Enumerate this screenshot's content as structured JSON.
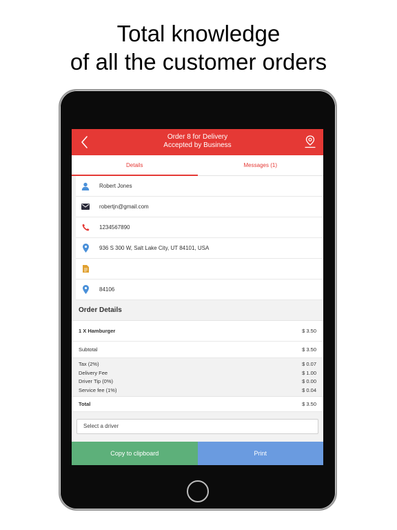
{
  "headline": {
    "line1": "Total knowledge",
    "line2": "of all the customer orders"
  },
  "navbar": {
    "title_line1": "Order 8 for Delivery",
    "title_line2": "Accepted by Business",
    "back_icon": "chevron-left-icon",
    "map_icon": "map-pin-icon"
  },
  "tabs": [
    {
      "label": "Details",
      "active": true
    },
    {
      "label": "Messages (1)",
      "active": false
    }
  ],
  "customer": {
    "name": "Robert Jones",
    "email": "robertjn@gmail.com",
    "phone": "1234567890",
    "address": "936 S 300 W, Salt Lake City, UT 84101, USA",
    "notes": "",
    "zip": "84106"
  },
  "order_details": {
    "header": "Order Details",
    "items": [
      {
        "label": "1 X Hamburger",
        "price": "$ 3.50"
      }
    ],
    "subtotal_label": "Subtotal",
    "subtotal": "$ 3.50",
    "fees": [
      {
        "label": "Tax (2%)",
        "value": "$ 0.07"
      },
      {
        "label": "Delivery Fee",
        "value": "$ 1.00"
      },
      {
        "label": "Driver Tip (0%)",
        "value": "$ 0.00"
      },
      {
        "label": "Service fee (1%)",
        "value": "$ 0.04"
      }
    ],
    "total_label": "Total",
    "total": "$ 3.50"
  },
  "driver_select": {
    "value": "Select a driver"
  },
  "buttons": {
    "copy": "Copy to clipboard",
    "print": "Print"
  },
  "colors": {
    "brand_red": "#e53935",
    "copy_green": "#5db07a",
    "print_blue": "#6a9be0",
    "person_icon": "#4a90d9",
    "mail_icon": "#2b2b3a",
    "phone_icon": "#e53935",
    "pin_icon": "#4a90d9",
    "note_icon": "#e0a030"
  }
}
